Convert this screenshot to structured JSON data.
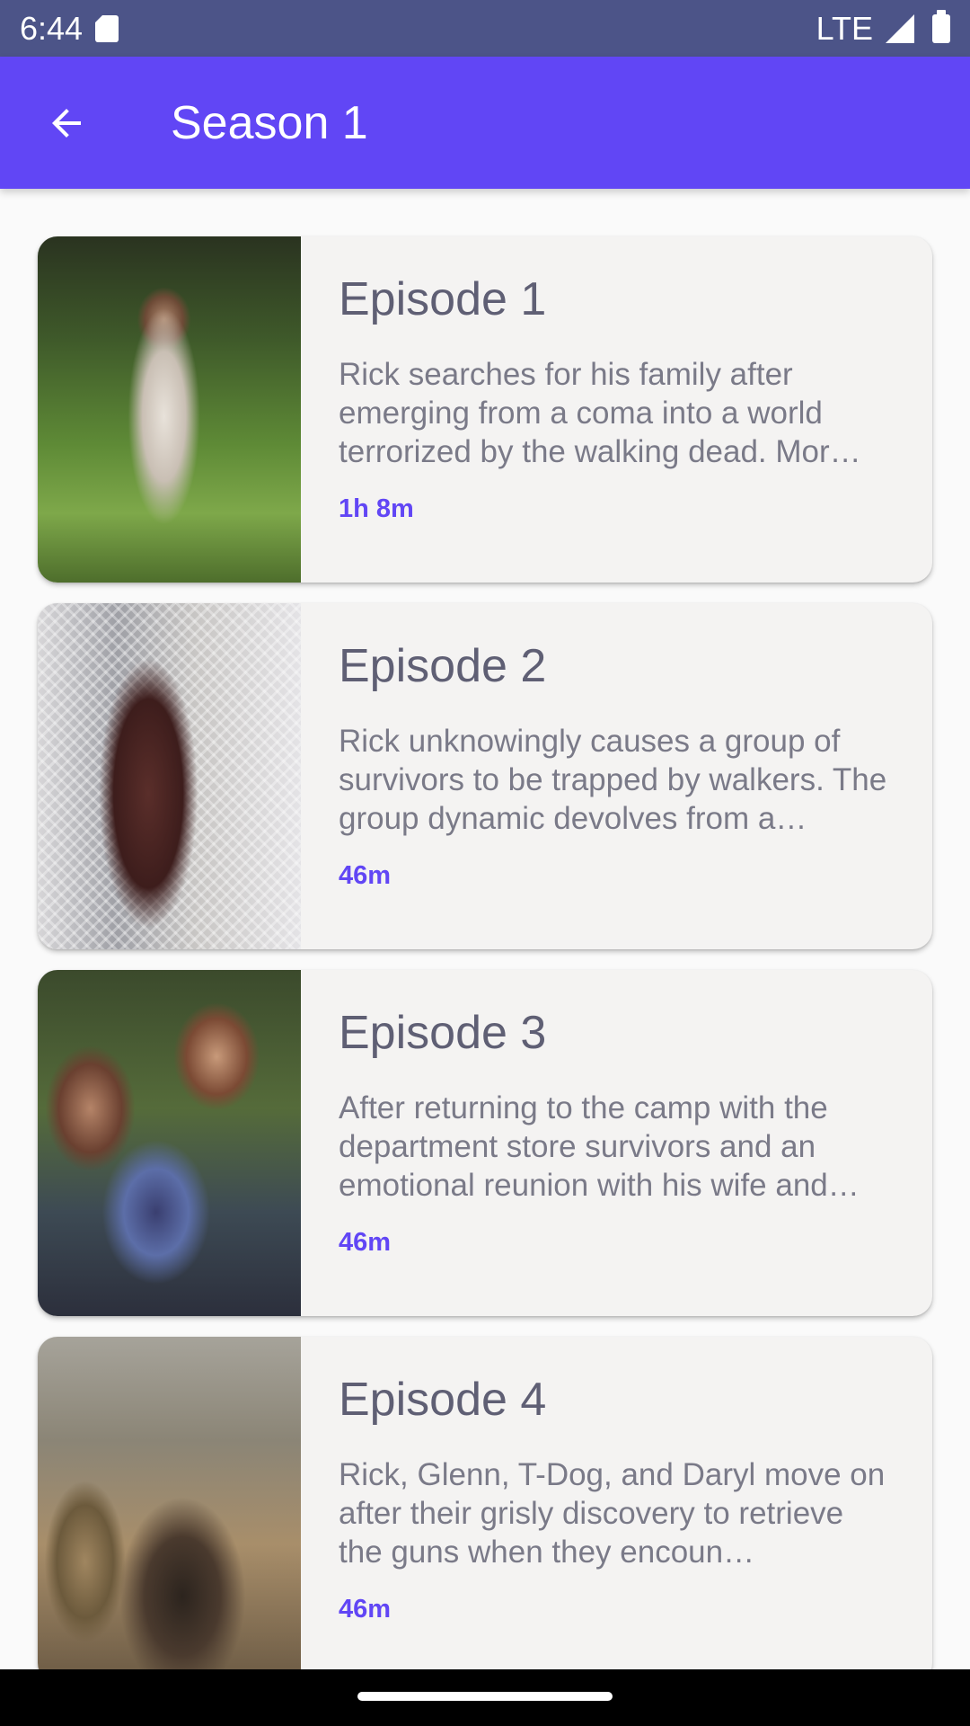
{
  "status_bar": {
    "time": "6:44",
    "network": "LTE"
  },
  "app_bar": {
    "title": "Season 1"
  },
  "episodes": [
    {
      "title": "Episode 1",
      "description": "Rick searches for his family after emerging from a coma into a world terrorized by the walking dead. Mor…",
      "duration": "1h 8m"
    },
    {
      "title": "Episode 2",
      "description": "Rick unknowingly causes a group of survivors to be trapped by walkers. The group dynamic devolves from a…",
      "duration": "46m"
    },
    {
      "title": "Episode 3",
      "description": "After returning to the camp with the department store survivors and an emotional reunion with his wife and…",
      "duration": "46m"
    },
    {
      "title": "Episode 4",
      "description": "Rick, Glenn, T-Dog, and Daryl move on after their grisly discovery to retrieve the guns when they encoun…",
      "duration": "46m"
    }
  ],
  "colors": {
    "status_bar": "#4c5488",
    "app_bar": "#6146f5",
    "accent": "#6146f5",
    "card": "#f4f3f2"
  },
  "icons": {
    "back": "arrow-left-icon",
    "sd_card": "sd-card-icon",
    "signal": "signal-icon",
    "battery": "battery-icon"
  }
}
